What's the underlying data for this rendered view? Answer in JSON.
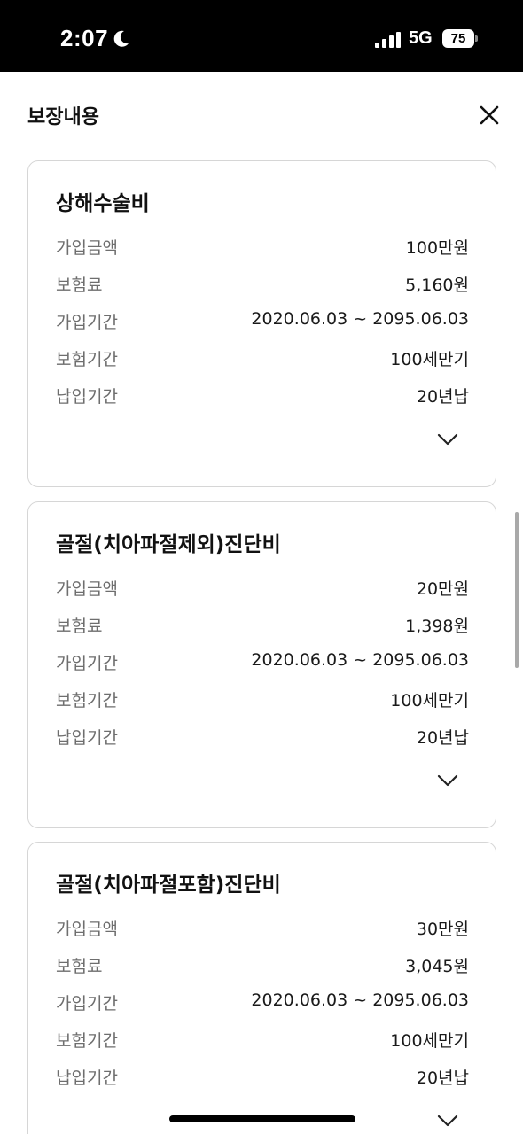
{
  "status_bar": {
    "time": "2:07",
    "network": "5G",
    "battery": "75"
  },
  "header": {
    "title": "보장내용"
  },
  "cards": [
    {
      "title": "상해수술비",
      "rows": [
        {
          "label": "가입금액",
          "value": "100만원"
        },
        {
          "label": "보험료",
          "value": "5,160원"
        },
        {
          "label": "가입기간",
          "value": "2020.06.03 ~ 2095.06.03"
        },
        {
          "label": "보험기간",
          "value": "100세만기"
        },
        {
          "label": "납입기간",
          "value": "20년납"
        }
      ]
    },
    {
      "title": "골절(치아파절제외)진단비",
      "rows": [
        {
          "label": "가입금액",
          "value": "20만원"
        },
        {
          "label": "보험료",
          "value": "1,398원"
        },
        {
          "label": "가입기간",
          "value": "2020.06.03 ~ 2095.06.03"
        },
        {
          "label": "보험기간",
          "value": "100세만기"
        },
        {
          "label": "납입기간",
          "value": "20년납"
        }
      ]
    },
    {
      "title": "골절(치아파절포함)진단비",
      "rows": [
        {
          "label": "가입금액",
          "value": "30만원"
        },
        {
          "label": "보험료",
          "value": "3,045원"
        },
        {
          "label": "가입기간",
          "value": "2020.06.03 ~ 2095.06.03"
        },
        {
          "label": "보험기간",
          "value": "100세만기"
        },
        {
          "label": "납입기간",
          "value": "20년납"
        }
      ]
    }
  ],
  "icons": {
    "close": "close-icon",
    "expand": "chevron-down-icon"
  }
}
